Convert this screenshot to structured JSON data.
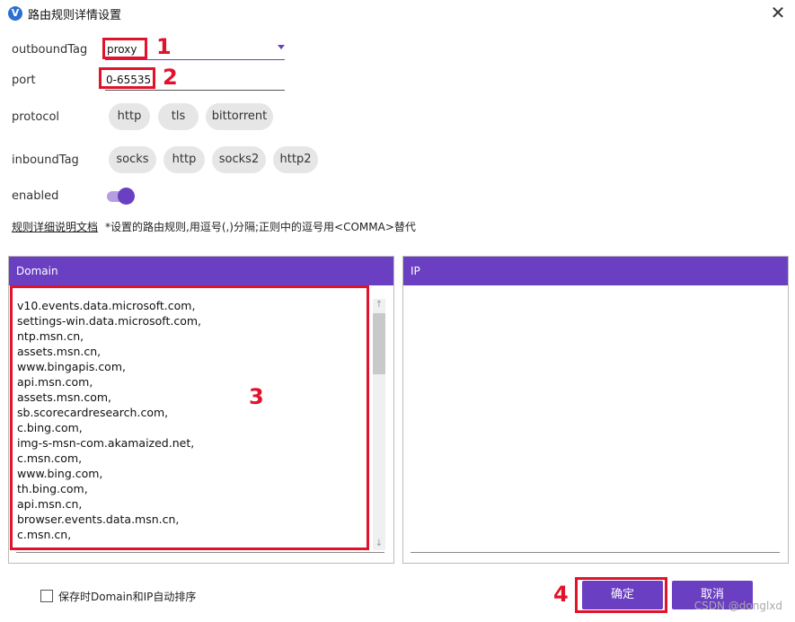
{
  "window": {
    "title": "路由规则详情设置",
    "close_glyph": "✕"
  },
  "form": {
    "outboundTag": {
      "label": "outboundTag",
      "value": "proxy"
    },
    "port": {
      "label": "port",
      "value": "0-65535"
    },
    "protocol": {
      "label": "protocol",
      "chips": [
        "http",
        "tls",
        "bittorrent"
      ]
    },
    "inboundTag": {
      "label": "inboundTag",
      "chips": [
        "socks",
        "http",
        "socks2",
        "http2"
      ]
    },
    "enabled": {
      "label": "enabled",
      "value": true
    },
    "doc_link": "规则详细说明文档",
    "hint": "*设置的路由规则,用逗号(,)分隔;正则中的逗号用<COMMA>替代"
  },
  "domain_panel": {
    "header": "Domain",
    "items": [
      "v10.events.data.microsoft.com,",
      "settings-win.data.microsoft.com,",
      "ntp.msn.cn,",
      "assets.msn.cn,",
      "www.bingapis.com,",
      "api.msn.com,",
      "assets.msn.com,",
      "sb.scorecardresearch.com,",
      "c.bing.com,",
      "img-s-msn-com.akamaized.net,",
      "c.msn.com,",
      "www.bing.com,",
      "th.bing.com,",
      "api.msn.cn,",
      "browser.events.data.msn.cn,",
      "c.msn.cn,"
    ]
  },
  "ip_panel": {
    "header": "IP"
  },
  "footer": {
    "sort_checkbox_label": "保存时Domain和IP自动排序",
    "confirm_label": "确定",
    "cancel_label": "取消"
  },
  "annotations": [
    "1",
    "2",
    "3",
    "4"
  ],
  "watermark": "CSDN @donglxd",
  "colors": {
    "accent": "#6a3fc1",
    "annotation_red": "#e0132b"
  }
}
